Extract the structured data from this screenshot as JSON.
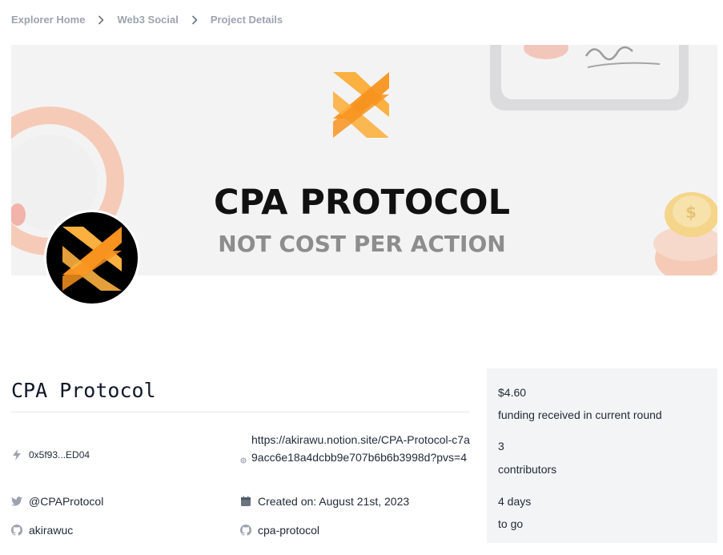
{
  "breadcrumb": {
    "items": [
      "Explorer Home",
      "Web3 Social",
      "Project Details"
    ]
  },
  "banner": {
    "title": "CPA PROTOCOL",
    "subtitle": "NOT COST PER ACTION",
    "colors": {
      "orange": "#f7931e",
      "orange_light": "#fbb040",
      "background": "#f3f3f3"
    }
  },
  "project": {
    "name": "CPA Protocol",
    "address": "0x5f93...ED04",
    "website": "https://akirawu.notion.site/CPA-Protocol-c7a9acc6e18a4dcbb9e707b6b6b3998d?pvs=4",
    "twitter": "@CPAProtocol",
    "created": "Created on: August 21st, 2023",
    "github_user": "akirawuc",
    "github_repo": "cpa-protocol"
  },
  "stats": [
    {
      "value": "$4.60",
      "label": "funding received in current round"
    },
    {
      "value": "3",
      "label": "contributors"
    },
    {
      "value": "4 days",
      "label": "to go"
    }
  ],
  "icons": {
    "address": "bolt-icon",
    "website": "globe-icon",
    "twitter": "twitter-icon",
    "calendar": "calendar-icon",
    "github": "github-icon",
    "chevron": "chevron-right-icon"
  }
}
